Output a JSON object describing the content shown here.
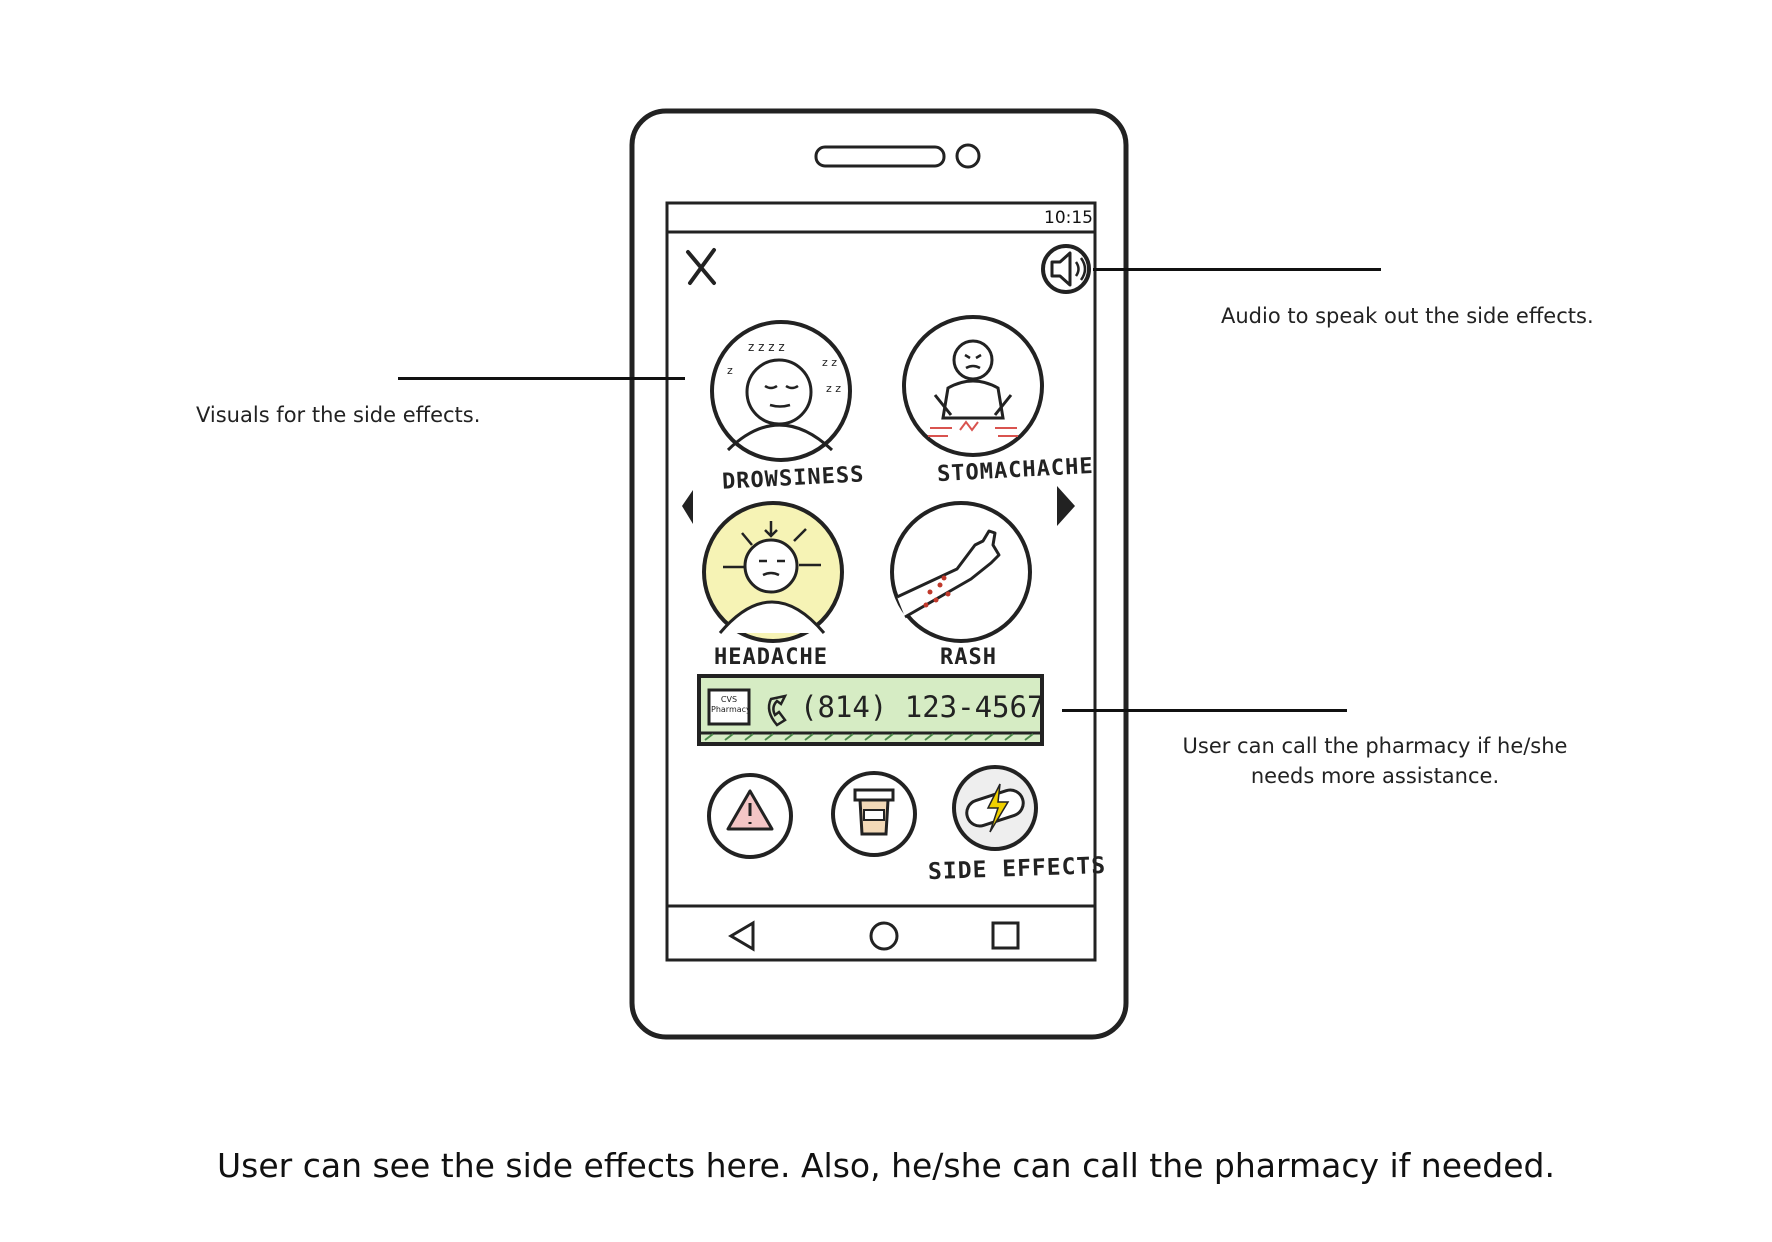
{
  "status_bar": {
    "time": "10:15"
  },
  "toolbar": {
    "close_icon": "close-icon",
    "audio_icon": "speaker-icon"
  },
  "side_effects": [
    {
      "label": "DROWSINESS",
      "icon": "sleeping-face-icon"
    },
    {
      "label": "STOMACHACHE",
      "icon": "stomach-pain-icon"
    },
    {
      "label": "HEADACHE",
      "icon": "headache-icon"
    },
    {
      "label": "RASH",
      "icon": "rash-arm-icon"
    }
  ],
  "pager": {
    "prev_icon": "prev-arrow-icon",
    "next_icon": "next-arrow-icon"
  },
  "pharmacy": {
    "logo_text": "CVS Pharmacy",
    "phone": "(814) 123-4567"
  },
  "bottom_tabs": [
    {
      "icon": "warning-icon",
      "label": ""
    },
    {
      "icon": "pill-bottle-icon",
      "label": ""
    },
    {
      "icon": "pill-lightning-icon",
      "label": "SIDE EFFECTS"
    }
  ],
  "nav_bar": {
    "back_icon": "back-icon",
    "home_icon": "home-icon",
    "recents_icon": "recents-icon"
  },
  "annotations": {
    "visuals": "Visuals for the side effects.",
    "audio": "Audio to speak out the side effects.",
    "call": "User can call the pharmacy if he/she needs more assistance."
  },
  "caption": "User can see the side effects here. Also, he/she can call the pharmacy if needed.",
  "colors": {
    "ink": "#222222",
    "call_bar": "#d6ecc4",
    "headache_glow": "#f3f0a6",
    "rash_dots": "#c0392b",
    "pain_marks": "#d9534f"
  }
}
